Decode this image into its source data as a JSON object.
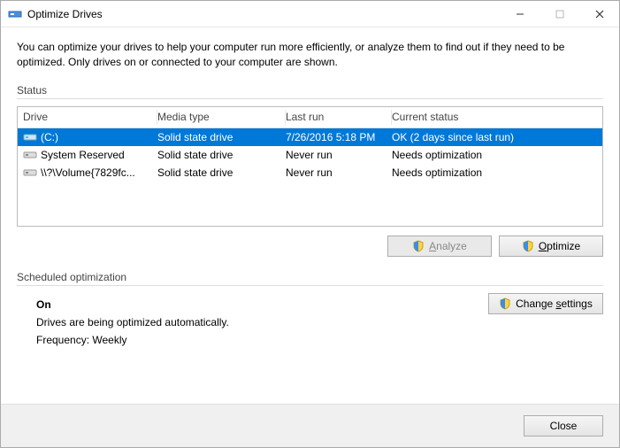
{
  "window": {
    "title": "Optimize Drives"
  },
  "intro": "You can optimize your drives to help your computer run more efficiently, or analyze them to find out if they need to be optimized. Only drives on or connected to your computer are shown.",
  "status": {
    "label": "Status",
    "columns": {
      "drive": "Drive",
      "media": "Media type",
      "last": "Last run",
      "status": "Current status"
    },
    "rows": [
      {
        "drive": "(C:)",
        "media": "Solid state drive",
        "last": "7/26/2016 5:18 PM",
        "status": "OK (2 days since last run)",
        "selected": true
      },
      {
        "drive": "System Reserved",
        "media": "Solid state drive",
        "last": "Never run",
        "status": "Needs optimization",
        "selected": false
      },
      {
        "drive": "\\\\?\\Volume{7829fc...",
        "media": "Solid state drive",
        "last": "Never run",
        "status": "Needs optimization",
        "selected": false
      }
    ]
  },
  "buttons": {
    "analyze": "Analyze",
    "optimize": "Optimize",
    "change_settings": "Change settings",
    "close": "Close"
  },
  "scheduled": {
    "label": "Scheduled optimization",
    "state": "On",
    "desc": "Drives are being optimized automatically.",
    "freq": "Frequency: Weekly"
  }
}
